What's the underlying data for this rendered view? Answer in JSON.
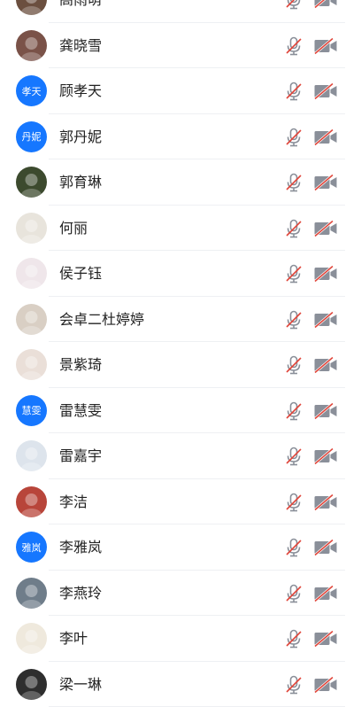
{
  "participants": [
    {
      "name": "高雨萌",
      "avatar_type": "photo",
      "avatar_bg": "#6b4f3f"
    },
    {
      "name": "龚晓雪",
      "avatar_type": "photo",
      "avatar_bg": "#7a5248"
    },
    {
      "name": "顾孝天",
      "avatar_type": "text",
      "avatar_text": "孝天"
    },
    {
      "name": "郭丹妮",
      "avatar_type": "text",
      "avatar_text": "丹妮"
    },
    {
      "name": "郭育琳",
      "avatar_type": "photo",
      "avatar_bg": "#3c4a2e"
    },
    {
      "name": "何丽",
      "avatar_type": "photo",
      "avatar_bg": "#e8e4dc"
    },
    {
      "name": "侯子钰",
      "avatar_type": "photo",
      "avatar_bg": "#efe6ea"
    },
    {
      "name": "会卓二杜婷婷",
      "avatar_type": "photo",
      "avatar_bg": "#d9cfc4"
    },
    {
      "name": "景紫琦",
      "avatar_type": "photo",
      "avatar_bg": "#eadfd8"
    },
    {
      "name": "雷慧雯",
      "avatar_type": "text",
      "avatar_text": "慧雯"
    },
    {
      "name": "雷嘉宇",
      "avatar_type": "photo",
      "avatar_bg": "#dde4ec"
    },
    {
      "name": "李洁",
      "avatar_type": "photo",
      "avatar_bg": "#b8453a"
    },
    {
      "name": "李雅岚",
      "avatar_type": "text",
      "avatar_text": "雅岚"
    },
    {
      "name": "李燕玲",
      "avatar_type": "photo",
      "avatar_bg": "#6f7d8a"
    },
    {
      "name": "李叶",
      "avatar_type": "photo",
      "avatar_bg": "#efe9dd"
    },
    {
      "name": "梁一琳",
      "avatar_type": "photo",
      "avatar_bg": "#2e2e2e"
    }
  ],
  "colors": {
    "accent": "#1677ff",
    "icon_gray": "#8a8f99",
    "slash_red": "#e0453a",
    "divider": "#eef0f3"
  },
  "icons": {
    "mic": "mic-muted-icon",
    "camera": "camera-off-icon"
  }
}
